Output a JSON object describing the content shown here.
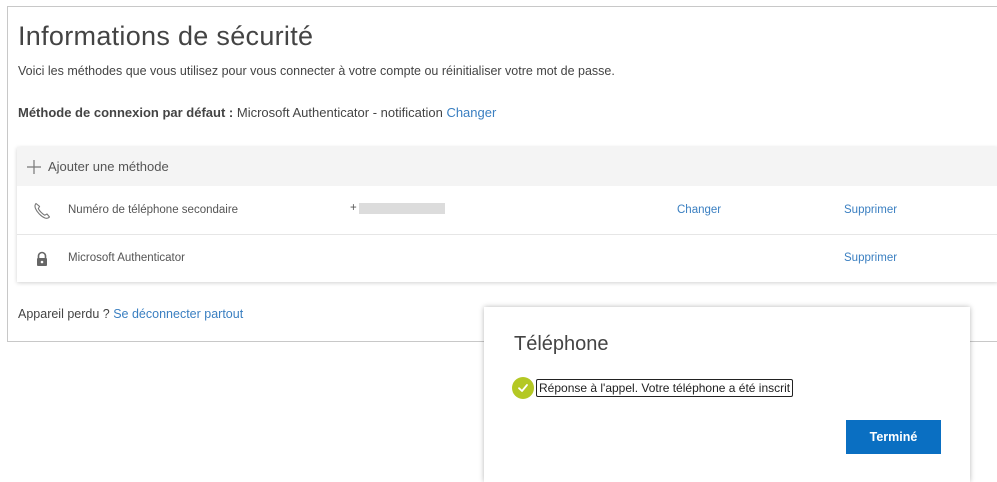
{
  "header": {
    "title": "Informations de sécurité",
    "subtitle": "Voici les méthodes que vous utilisez pour vous connecter à votre compte ou réinitialiser votre mot de passe.",
    "default_label": "Méthode de connexion par défaut :",
    "default_value": "Microsoft Authenticator - notification",
    "default_change": "Changer"
  },
  "methods": {
    "add_label": "Ajouter une méthode",
    "rows": [
      {
        "icon": "phone-icon",
        "name": "Numéro de téléphone secondaire",
        "value_prefix": "+",
        "change": "Changer",
        "delete": "Supprimer"
      },
      {
        "icon": "lock-icon",
        "name": "Microsoft Authenticator",
        "delete": "Supprimer"
      }
    ]
  },
  "footer": {
    "lost_text": "Appareil perdu ?",
    "signout_link": "Se déconnecter partout"
  },
  "dialog": {
    "title": "Téléphone",
    "message": "Réponse à l'appel. Votre téléphone a été inscrit",
    "done_button": "Terminé"
  },
  "colors": {
    "link": "#3a7fc1",
    "primary_button": "#0a6fc2",
    "success_check": "#b4c824"
  }
}
